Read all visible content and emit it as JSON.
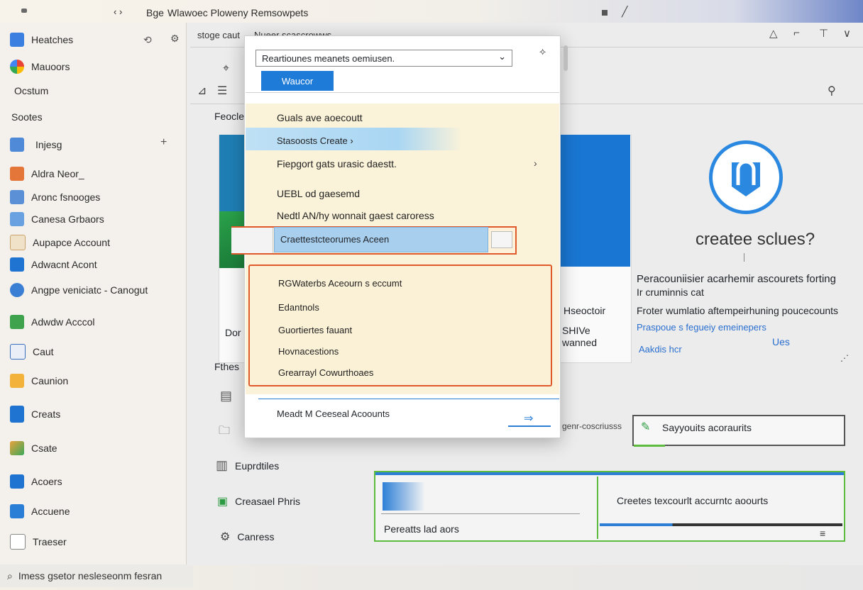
{
  "window": {
    "title_short": "Bge",
    "title": "Wlawoec  Ploweny  Remsowpets"
  },
  "sidebar": {
    "items": [
      {
        "label": "Heatches"
      },
      {
        "label": "Mauoors"
      },
      {
        "label": "Ocstum"
      },
      {
        "label": "Sootes"
      },
      {
        "label": "Injesg"
      },
      {
        "label": "Aldra Neor_"
      },
      {
        "label": "Aronc fsnooges"
      },
      {
        "label": "Canesa Grbaors"
      },
      {
        "label": "Aupapce Account"
      },
      {
        "label": "Adwacnt Acont"
      },
      {
        "label": "Angpe veniciatc - Canogut"
      },
      {
        "label": "Adwdw Acccol"
      },
      {
        "label": "Caut"
      },
      {
        "label": "Caunion"
      },
      {
        "label": "Creats"
      },
      {
        "label": "Csate"
      },
      {
        "label": "Acoers"
      },
      {
        "label": "Accuene"
      },
      {
        "label": "Traeser"
      }
    ],
    "footer": "Imess gsetor nesleseonm fesran"
  },
  "toolbar": {
    "breadcrumb": "stoge caut",
    "breadcrumb2": "Nueer scascrowws"
  },
  "modal": {
    "dropdown_value": "Reartiounes meanets oemiusen.",
    "button_label": "Waucor",
    "menu_items": [
      {
        "label": "Guals ave aoecoutt"
      },
      {
        "label": "Stasoosts Create ›"
      },
      {
        "label": "Fiepgort gats urasic daestt."
      },
      {
        "label": "UEBL od gaesemd"
      },
      {
        "label": "Nedtl AN/hy wonnait gaest caroress"
      },
      {
        "label": "Craettestcteorumes Aceen"
      }
    ],
    "submenu_items": [
      {
        "label": "RGWaterbs Aceourn s eccumt"
      },
      {
        "label": "Edantnols"
      },
      {
        "label": "Guortiertes fauant"
      },
      {
        "label": "Hovnacestions"
      },
      {
        "label": "Grearrayl Cowurthoaes"
      }
    ],
    "footer_text": "Meadt  M Ceeseal Acoounts"
  },
  "main": {
    "left_labels": [
      "Feocle",
      "Dor",
      "Fthes"
    ],
    "blue_card_caption": "Hseoctoir",
    "blue_card_caption2": "SHIVe\nwanned",
    "right_title": "createe sclues?",
    "right_desc1": "Peracouniisier acarhemir ascourets forting",
    "right_desc2": "Ir cruminnis cat",
    "right_desc3": "Froter wumlatio aftempeirhuning poucecounts",
    "right_link": "Praspoue s fegueiy emeinepers",
    "right_link2": "Aakdis hcr",
    "right_uses": "Ues",
    "input_prefix": "genr-coscriusss",
    "input_value": "Sayyouits acoraurits",
    "list_items": [
      {
        "label": "Euprdtiles"
      },
      {
        "label": "Creasael Phris"
      },
      {
        "label": "Canress"
      }
    ],
    "green_left_label": "Pereatts lad aors",
    "green_right_label": "Creetes texcourlt accurntc aoourts"
  },
  "colors": {
    "accent": "#1e7bd8",
    "highlight_border": "#e0592a",
    "green_border": "#5dbb3d"
  }
}
